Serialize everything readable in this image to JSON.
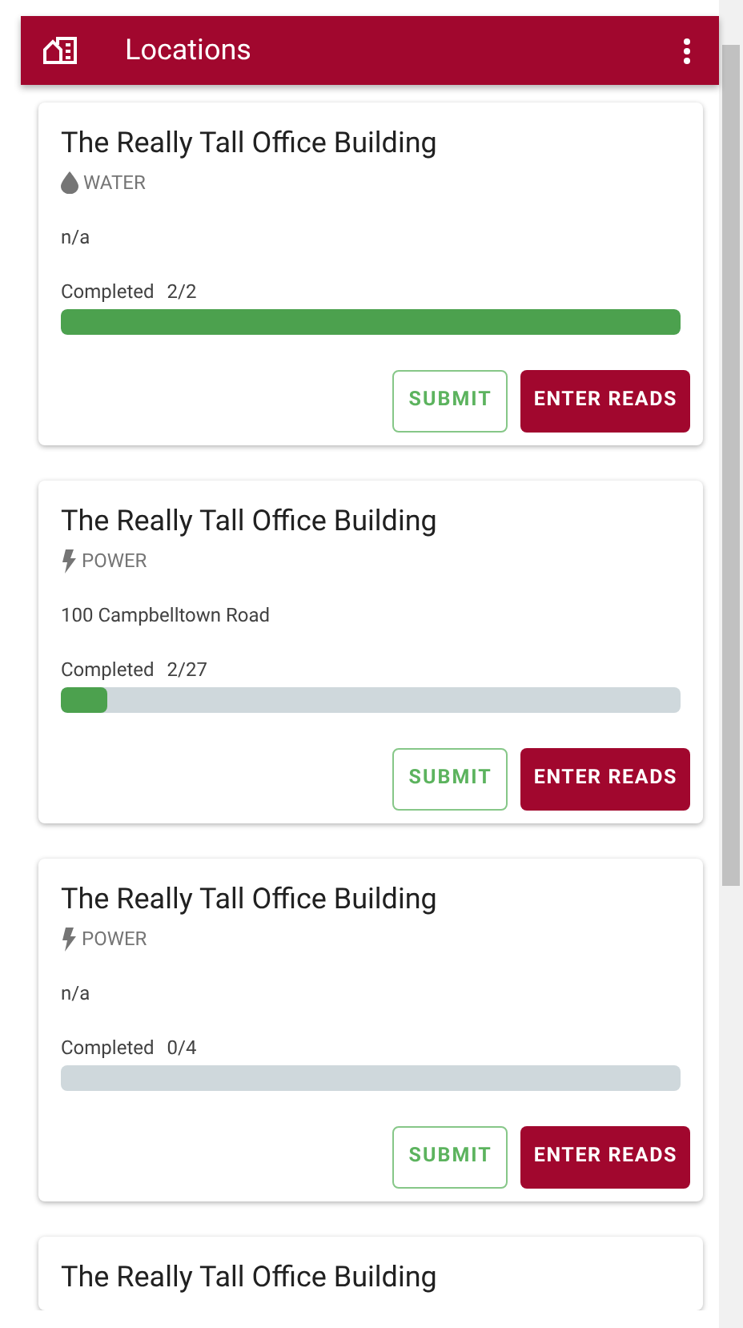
{
  "app_bar": {
    "title": "Locations"
  },
  "locations": [
    {
      "name": "The Really Tall Office Building",
      "utility": {
        "kind": "water",
        "label": "WATER"
      },
      "address": "n/a",
      "progress_label": "Completed",
      "progress_count": "2/2",
      "level": 1,
      "actions": [
        "SUBMIT",
        "ENTER READS"
      ]
    },
    {
      "name": "The Really Tall Office Building",
      "utility": {
        "kind": "power",
        "label": "POWER"
      },
      "address": "100 Campbelltown Road",
      "progress_label": "Completed",
      "progress_count": "2/27",
      "level": 0.074,
      "actions": [
        "SUBMIT",
        "ENTER READS"
      ]
    },
    {
      "name": "The Really Tall Office Building",
      "utility": {
        "kind": "power",
        "label": "POWER"
      },
      "address": "n/a",
      "progress_label": "Completed",
      "progress_count": "0/4",
      "level": 0,
      "actions": [
        "SUBMIT",
        "ENTER READS"
      ]
    },
    {
      "name": "The Really Tall Office Building"
    }
  ]
}
